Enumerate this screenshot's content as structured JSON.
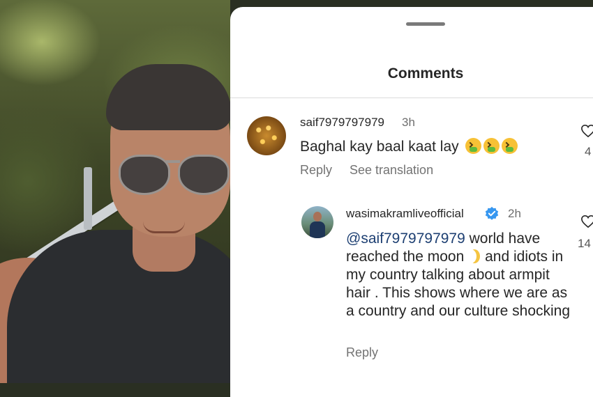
{
  "sheet": {
    "title": "Comments"
  },
  "comments": [
    {
      "username": "saif7979797979",
      "time": "3h",
      "text": "Baghal kay baal kaat lay",
      "emoji": [
        "nauseated-face",
        "nauseated-face",
        "nauseated-face"
      ],
      "reply_label": "Reply",
      "translate_label": "See translation",
      "like_count": "4"
    },
    {
      "username": "wasimakramliveofficial",
      "verified": true,
      "time": "2h",
      "mention": "@saif7979797979",
      "text_part1": " world have reached the  moon",
      "text_part2": " and idiots in my country talking about armpit hair . This shows where we are as a country and our culture shocking",
      "reply_label": "Reply",
      "like_count": "14"
    }
  ],
  "colors": {
    "mention": "#1d3f72",
    "verified": "#3797f0",
    "muted": "#737373"
  },
  "icons": [
    "heart-icon",
    "verified-badge-icon",
    "moon-emoji",
    "nauseated-face-emoji"
  ]
}
